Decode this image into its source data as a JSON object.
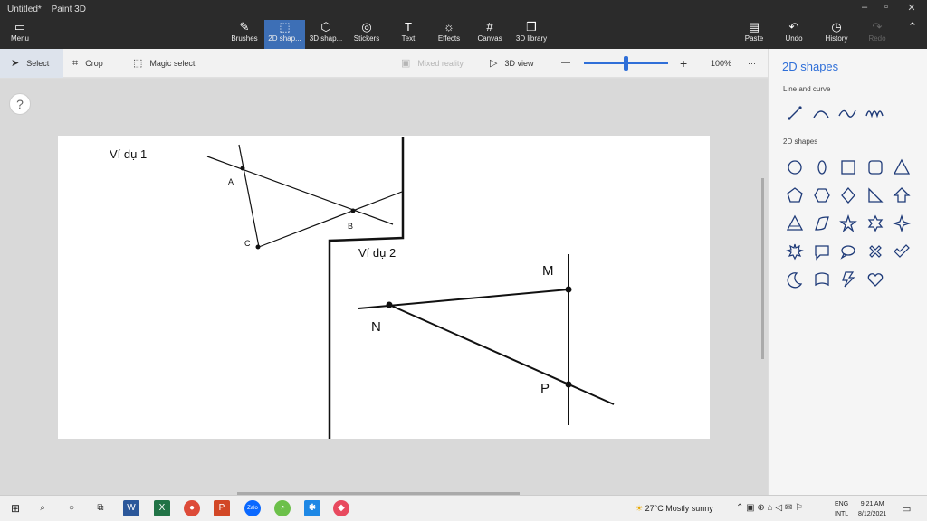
{
  "window": {
    "doc_name": "Untitled*",
    "app_name": "Paint 3D",
    "minimize_glyph": "–",
    "maximize_glyph": "▫",
    "close_glyph": "✕"
  },
  "ribbon": {
    "menu": {
      "label": "Menu",
      "icon": "menu-icon"
    },
    "tools": [
      {
        "label": "Brushes",
        "icon": "brush-icon"
      },
      {
        "label": "2D shap...",
        "icon": "2d-shapes-icon",
        "active": true
      },
      {
        "label": "3D shap...",
        "icon": "3d-shapes-icon"
      },
      {
        "label": "Stickers",
        "icon": "stickers-icon"
      },
      {
        "label": "Text",
        "icon": "text-icon"
      },
      {
        "label": "Effects",
        "icon": "effects-icon"
      },
      {
        "label": "Canvas",
        "icon": "canvas-icon"
      },
      {
        "label": "3D library",
        "icon": "3d-library-icon"
      }
    ],
    "right": [
      {
        "label": "Paste",
        "icon": "paste-icon"
      },
      {
        "label": "Undo",
        "icon": "undo-icon"
      },
      {
        "label": "History",
        "icon": "history-icon"
      },
      {
        "label": "Redo",
        "icon": "redo-icon",
        "disabled": true
      }
    ]
  },
  "toolbar": {
    "select": "Select",
    "crop": "Crop",
    "magic_select": "Magic select",
    "mixed_reality": "Mixed reality",
    "view_3d": "3D view",
    "zoom_out": "—",
    "zoom_in": "+",
    "zoom_level": "100%",
    "zoom_fraction": 0.48,
    "more": "···"
  },
  "help": "?",
  "canvas": {
    "example1_title": "Ví dụ 1",
    "example2_title": "Ví dụ 2",
    "points1": {
      "A": "A",
      "B": "B",
      "C": "C"
    },
    "points2": {
      "M": "M",
      "N": "N",
      "P": "P"
    }
  },
  "panel": {
    "title": "2D shapes",
    "section_lines": "Line and curve",
    "section_shapes": "2D shapes",
    "line_icons": [
      "line-icon",
      "curve-icon",
      "wave-curve-icon",
      "zigzag-curve-icon"
    ],
    "shape_icons": [
      "circle-icon",
      "ellipse-icon",
      "square-icon",
      "rounded-square-icon",
      "triangle-icon",
      "pentagon-icon",
      "hexagon-icon",
      "diamond-icon",
      "right-triangle-icon",
      "arrow-up-icon",
      "triangle-outline-icon",
      "parallelogram-icon",
      "star5-icon",
      "star6-icon",
      "star4-icon",
      "burst-icon",
      "speech-bubble-icon",
      "thought-bubble-icon",
      "x-mark-icon",
      "checkmark-icon",
      "moon-icon",
      "banner-icon",
      "lightning-icon",
      "heart-icon"
    ]
  },
  "taskbar": {
    "weather": "27°C  Mostly sunny",
    "lang1": "ENG",
    "lang2": "INTL",
    "time": "9:21 AM",
    "date": "8/12/2021"
  }
}
